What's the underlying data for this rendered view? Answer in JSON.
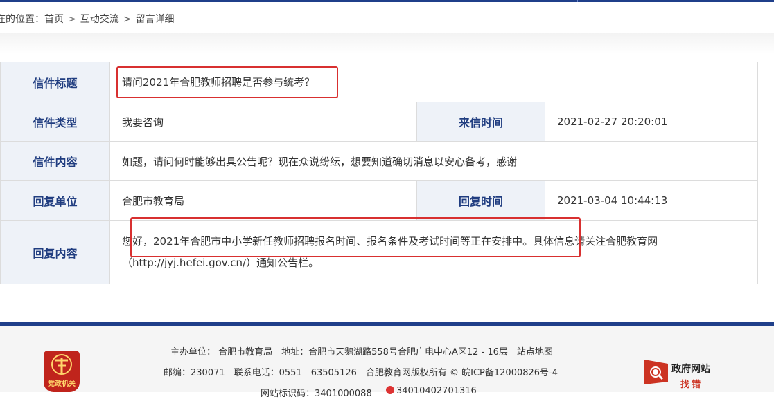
{
  "breadcrumb": {
    "prefix": "在的位置：",
    "items": [
      "首页",
      "互动交流",
      "留言详细"
    ],
    "separator": ">"
  },
  "letter": {
    "title_label": "信件标题",
    "title_value": "请问2021年合肥教师招聘是否参与统考？",
    "type_label": "信件类型",
    "type_value": "我要咨询",
    "time_label": "来信时间",
    "time_value": "2021-02-27 20:20:01",
    "content_label": "信件内容",
    "content_value": "如题，请问何时能够出具公告呢？现在众说纷纭，想要知道确切消息以安心备考，感谢",
    "reply_unit_label": "回复单位",
    "reply_unit_value": "合肥市教育局",
    "reply_time_label": "回复时间",
    "reply_time_value": "2021-03-04 10:44:13",
    "reply_content_label": "回复内容",
    "reply_content_value": "您好，2021年合肥市中小学新任教师招聘报名时间、报名条件及考试时间等正在安排中。具体信息请关注合肥教育网（http://jyj.hefei.gov.cn/）通知公告栏。"
  },
  "footer": {
    "line1": "主办单位： 合肥市教育局　地址：合肥市天鹅湖路558号合肥广电中心A区12 - 16层　站点地图",
    "line2": "邮编：230071　联系电话：0551—63505126　合肥教育网版权所有 © 皖ICP备12000826号-4",
    "line3a": "网站标识码：3401000088",
    "line3b": "34010402701316",
    "badge_text": "党政机关",
    "error_title": "政府网站",
    "error_sub": "找错"
  },
  "colors": {
    "header_blue": "#1f3f8a",
    "label_bg": "#eef2f8",
    "label_text": "#203d80",
    "highlight_red": "#d83030"
  }
}
